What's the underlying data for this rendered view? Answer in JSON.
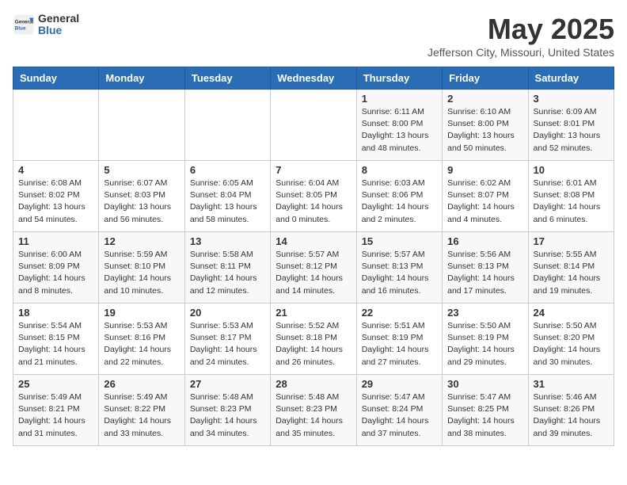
{
  "header": {
    "logo_general": "General",
    "logo_blue": "Blue",
    "title": "May 2025",
    "subtitle": "Jefferson City, Missouri, United States"
  },
  "weekdays": [
    "Sunday",
    "Monday",
    "Tuesday",
    "Wednesday",
    "Thursday",
    "Friday",
    "Saturday"
  ],
  "weeks": [
    [
      {
        "day": "",
        "info": ""
      },
      {
        "day": "",
        "info": ""
      },
      {
        "day": "",
        "info": ""
      },
      {
        "day": "",
        "info": ""
      },
      {
        "day": "1",
        "info": "Sunrise: 6:11 AM\nSunset: 8:00 PM\nDaylight: 13 hours\nand 48 minutes."
      },
      {
        "day": "2",
        "info": "Sunrise: 6:10 AM\nSunset: 8:00 PM\nDaylight: 13 hours\nand 50 minutes."
      },
      {
        "day": "3",
        "info": "Sunrise: 6:09 AM\nSunset: 8:01 PM\nDaylight: 13 hours\nand 52 minutes."
      }
    ],
    [
      {
        "day": "4",
        "info": "Sunrise: 6:08 AM\nSunset: 8:02 PM\nDaylight: 13 hours\nand 54 minutes."
      },
      {
        "day": "5",
        "info": "Sunrise: 6:07 AM\nSunset: 8:03 PM\nDaylight: 13 hours\nand 56 minutes."
      },
      {
        "day": "6",
        "info": "Sunrise: 6:05 AM\nSunset: 8:04 PM\nDaylight: 13 hours\nand 58 minutes."
      },
      {
        "day": "7",
        "info": "Sunrise: 6:04 AM\nSunset: 8:05 PM\nDaylight: 14 hours\nand 0 minutes."
      },
      {
        "day": "8",
        "info": "Sunrise: 6:03 AM\nSunset: 8:06 PM\nDaylight: 14 hours\nand 2 minutes."
      },
      {
        "day": "9",
        "info": "Sunrise: 6:02 AM\nSunset: 8:07 PM\nDaylight: 14 hours\nand 4 minutes."
      },
      {
        "day": "10",
        "info": "Sunrise: 6:01 AM\nSunset: 8:08 PM\nDaylight: 14 hours\nand 6 minutes."
      }
    ],
    [
      {
        "day": "11",
        "info": "Sunrise: 6:00 AM\nSunset: 8:09 PM\nDaylight: 14 hours\nand 8 minutes."
      },
      {
        "day": "12",
        "info": "Sunrise: 5:59 AM\nSunset: 8:10 PM\nDaylight: 14 hours\nand 10 minutes."
      },
      {
        "day": "13",
        "info": "Sunrise: 5:58 AM\nSunset: 8:11 PM\nDaylight: 14 hours\nand 12 minutes."
      },
      {
        "day": "14",
        "info": "Sunrise: 5:57 AM\nSunset: 8:12 PM\nDaylight: 14 hours\nand 14 minutes."
      },
      {
        "day": "15",
        "info": "Sunrise: 5:57 AM\nSunset: 8:13 PM\nDaylight: 14 hours\nand 16 minutes."
      },
      {
        "day": "16",
        "info": "Sunrise: 5:56 AM\nSunset: 8:13 PM\nDaylight: 14 hours\nand 17 minutes."
      },
      {
        "day": "17",
        "info": "Sunrise: 5:55 AM\nSunset: 8:14 PM\nDaylight: 14 hours\nand 19 minutes."
      }
    ],
    [
      {
        "day": "18",
        "info": "Sunrise: 5:54 AM\nSunset: 8:15 PM\nDaylight: 14 hours\nand 21 minutes."
      },
      {
        "day": "19",
        "info": "Sunrise: 5:53 AM\nSunset: 8:16 PM\nDaylight: 14 hours\nand 22 minutes."
      },
      {
        "day": "20",
        "info": "Sunrise: 5:53 AM\nSunset: 8:17 PM\nDaylight: 14 hours\nand 24 minutes."
      },
      {
        "day": "21",
        "info": "Sunrise: 5:52 AM\nSunset: 8:18 PM\nDaylight: 14 hours\nand 26 minutes."
      },
      {
        "day": "22",
        "info": "Sunrise: 5:51 AM\nSunset: 8:19 PM\nDaylight: 14 hours\nand 27 minutes."
      },
      {
        "day": "23",
        "info": "Sunrise: 5:50 AM\nSunset: 8:19 PM\nDaylight: 14 hours\nand 29 minutes."
      },
      {
        "day": "24",
        "info": "Sunrise: 5:50 AM\nSunset: 8:20 PM\nDaylight: 14 hours\nand 30 minutes."
      }
    ],
    [
      {
        "day": "25",
        "info": "Sunrise: 5:49 AM\nSunset: 8:21 PM\nDaylight: 14 hours\nand 31 minutes."
      },
      {
        "day": "26",
        "info": "Sunrise: 5:49 AM\nSunset: 8:22 PM\nDaylight: 14 hours\nand 33 minutes."
      },
      {
        "day": "27",
        "info": "Sunrise: 5:48 AM\nSunset: 8:23 PM\nDaylight: 14 hours\nand 34 minutes."
      },
      {
        "day": "28",
        "info": "Sunrise: 5:48 AM\nSunset: 8:23 PM\nDaylight: 14 hours\nand 35 minutes."
      },
      {
        "day": "29",
        "info": "Sunrise: 5:47 AM\nSunset: 8:24 PM\nDaylight: 14 hours\nand 37 minutes."
      },
      {
        "day": "30",
        "info": "Sunrise: 5:47 AM\nSunset: 8:25 PM\nDaylight: 14 hours\nand 38 minutes."
      },
      {
        "day": "31",
        "info": "Sunrise: 5:46 AM\nSunset: 8:26 PM\nDaylight: 14 hours\nand 39 minutes."
      }
    ]
  ]
}
